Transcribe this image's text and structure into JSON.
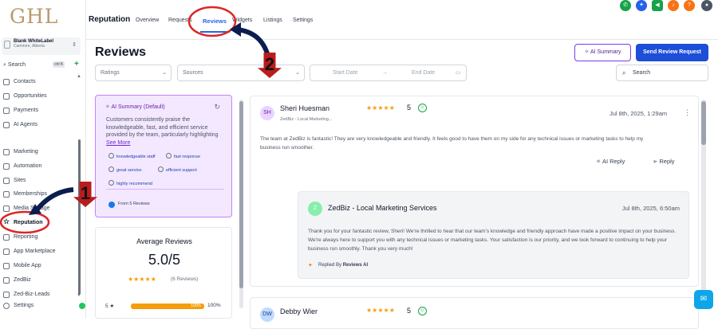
{
  "brand": {
    "logo": "GHL"
  },
  "account": {
    "name": "Blank WhiteLabel",
    "location": "Canmore, Alberta"
  },
  "search": {
    "label": "Search",
    "shortcut": "ctrl K",
    "plus": "+"
  },
  "sidebar": {
    "items": [
      {
        "label": "Contacts",
        "icon": "contacts-icon"
      },
      {
        "label": "Opportunities",
        "icon": "opportunities-icon"
      },
      {
        "label": "Payments",
        "icon": "payments-icon"
      },
      {
        "label": "AI Agents",
        "icon": "ai-agents-icon"
      },
      {
        "label": "Marketing",
        "icon": "marketing-icon"
      },
      {
        "label": "Automation",
        "icon": "automation-icon"
      },
      {
        "label": "Sites",
        "icon": "sites-icon"
      },
      {
        "label": "Memberships",
        "icon": "memberships-icon"
      },
      {
        "label": "Media Storage",
        "icon": "media-icon"
      },
      {
        "label": "Reputation",
        "icon": "star-icon"
      },
      {
        "label": "Reporting",
        "icon": "reporting-icon"
      },
      {
        "label": "App Marketplace",
        "icon": "marketplace-icon"
      },
      {
        "label": "Mobile App",
        "icon": "mobile-icon"
      },
      {
        "label": "ZedBiz",
        "icon": "zedbiz-icon"
      },
      {
        "label": "Zed-Biz-Leads",
        "icon": "leads-icon"
      },
      {
        "label": "Settings",
        "icon": "gear-icon"
      }
    ]
  },
  "topbar": {
    "title": "Reputation",
    "tabs": [
      "Overview",
      "Requests",
      "Reviews",
      "Widgets",
      "Listings",
      "Settings"
    ],
    "active_tab": "Reviews",
    "icon_colors": [
      "#16a34a",
      "#2563eb",
      "#16a34a",
      "#f97316",
      "#f97316"
    ]
  },
  "page": {
    "title": "Reviews",
    "ai_summary_button": "AI Summary",
    "send_button": "Send Review Request"
  },
  "filters": {
    "ratings": "Ratings",
    "sources": "Sources",
    "start_date": "Start Date",
    "end_date": "End Date",
    "arrow": "→",
    "search_placeholder": "Search"
  },
  "ai_summary": {
    "title": "AI Summary (Default)",
    "text": "Customers consistently praise the knowledgeable, fast, and efficient service provided by the team, particularly highlighting",
    "see_more": "See More",
    "tags": [
      "knowledgeable staff",
      "fast response",
      "great service",
      "efficient support",
      "highly recommend"
    ],
    "from": "From 5 Reviews"
  },
  "average": {
    "title": "Average Reviews",
    "value": "5.0/5",
    "stars": "★★★★★",
    "count": "(6 Reviews)",
    "row_label": "5 ★",
    "bar_label": "100%",
    "bar_fraction": 1.0,
    "percent": "100%"
  },
  "reviews": [
    {
      "initials": "SH",
      "name": "Sheri Huesman",
      "stars": "★★★★★",
      "rating": "5",
      "source": "ZedBiz - Local Marketing...",
      "date": "Jul 8th, 2025, 1:29am",
      "text": "The team at ZedBiz is fantastic! They are very knowledgeable and friendly. It feels good to have them on my side for any technical issues or marketing tasks to help my business run smoother.",
      "ai_reply": "AI Reply",
      "reply": "Reply",
      "response": {
        "initial": "Z",
        "name": "ZedBiz - Local Marketing Services",
        "date": "Jul 8th, 2025, 6:50am",
        "text": "Thank you for your fantastic review, Sheri! We're thrilled to hear that our team's knowledge and friendly approach have made a positive impact on your business. We're always here to support you with any technical issues or marketing tasks. Your satisfaction is our priority, and we look forward to continuing to help your business run smoothly. Thank you very much!",
        "replied_by": "Replied By",
        "replied_by_name": "Reviews AI"
      }
    },
    {
      "initials": "DW",
      "name": "Debby Wier",
      "stars": "★★★★★",
      "rating": "5"
    }
  ],
  "annotations": {
    "badge1": "1",
    "badge2": "2"
  }
}
